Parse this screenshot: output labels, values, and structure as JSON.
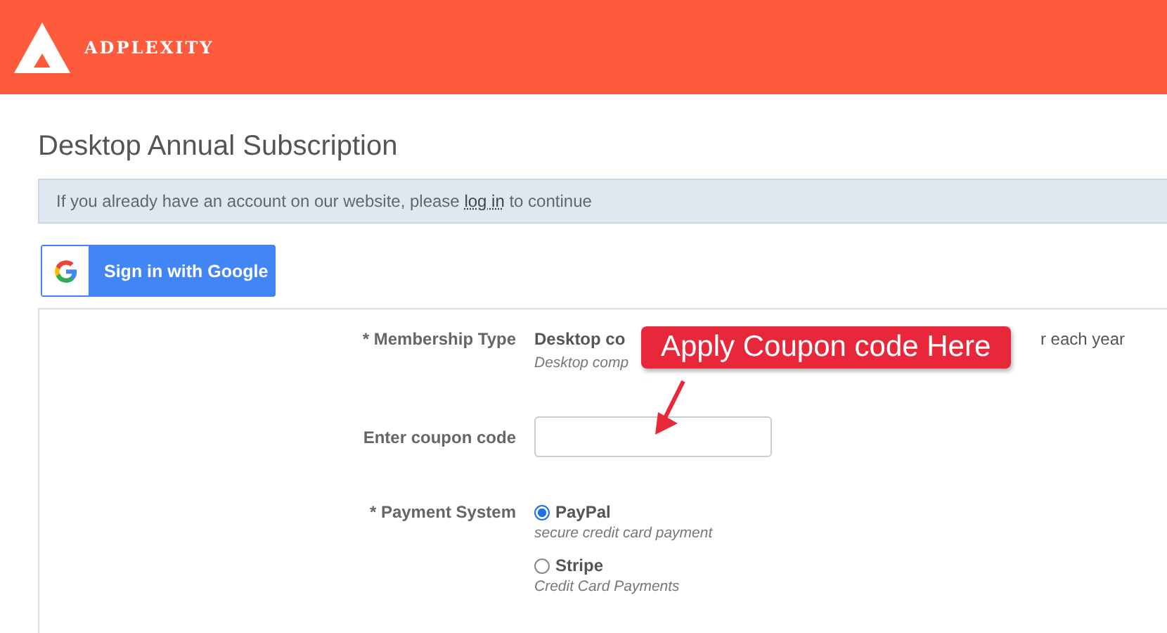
{
  "header": {
    "brand": "ADPLEXITY"
  },
  "title": "Desktop Annual Subscription",
  "notice": {
    "before": "If you already have an account on our website, please",
    "link": "log in",
    "after": "to continue"
  },
  "google_button": {
    "label": "Sign in with Google"
  },
  "form": {
    "membership": {
      "label": "* Membership Type",
      "value_start": "Desktop co",
      "value_end": "r each year",
      "description_start": "Desktop comp"
    },
    "coupon": {
      "label": "Enter coupon code"
    },
    "payment": {
      "label": "* Payment System",
      "options": [
        {
          "name": "PayPal",
          "description": "secure credit card payment",
          "selected": true
        },
        {
          "name": "Stripe",
          "description": "Credit Card Payments",
          "selected": false
        }
      ]
    }
  },
  "callout": {
    "text": "Apply Coupon code Here"
  }
}
